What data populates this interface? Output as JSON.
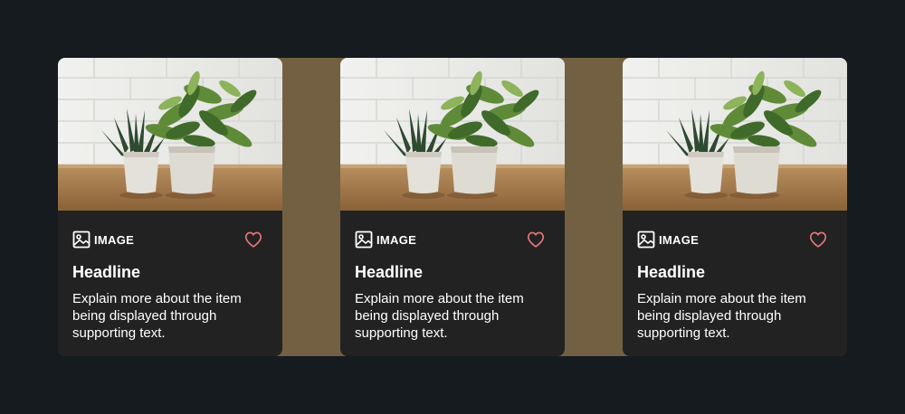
{
  "cards": [
    {
      "media_alt": "potted plants on wooden table",
      "type_icon": "image-icon",
      "type_label": "IMAGE",
      "favorite_icon": "heart-icon",
      "headline": "Headline",
      "description": "Explain more about the item being displayed through supporting text."
    },
    {
      "media_alt": "potted plants on wooden table",
      "type_icon": "image-icon",
      "type_label": "IMAGE",
      "favorite_icon": "heart-icon",
      "headline": "Headline",
      "description": "Explain more about the item being displayed through supporting text."
    },
    {
      "media_alt": "potted plants on wooden table",
      "type_icon": "image-icon",
      "type_label": "IMAGE",
      "favorite_icon": "heart-icon",
      "headline": "Headline",
      "description": "Explain more about the item being displayed through supporting text."
    }
  ],
  "colors": {
    "page_background": "#151b1e",
    "card_background": "#222222",
    "gap_accent": "#736043",
    "favorite": "#e8777a",
    "text": "#ffffff"
  }
}
